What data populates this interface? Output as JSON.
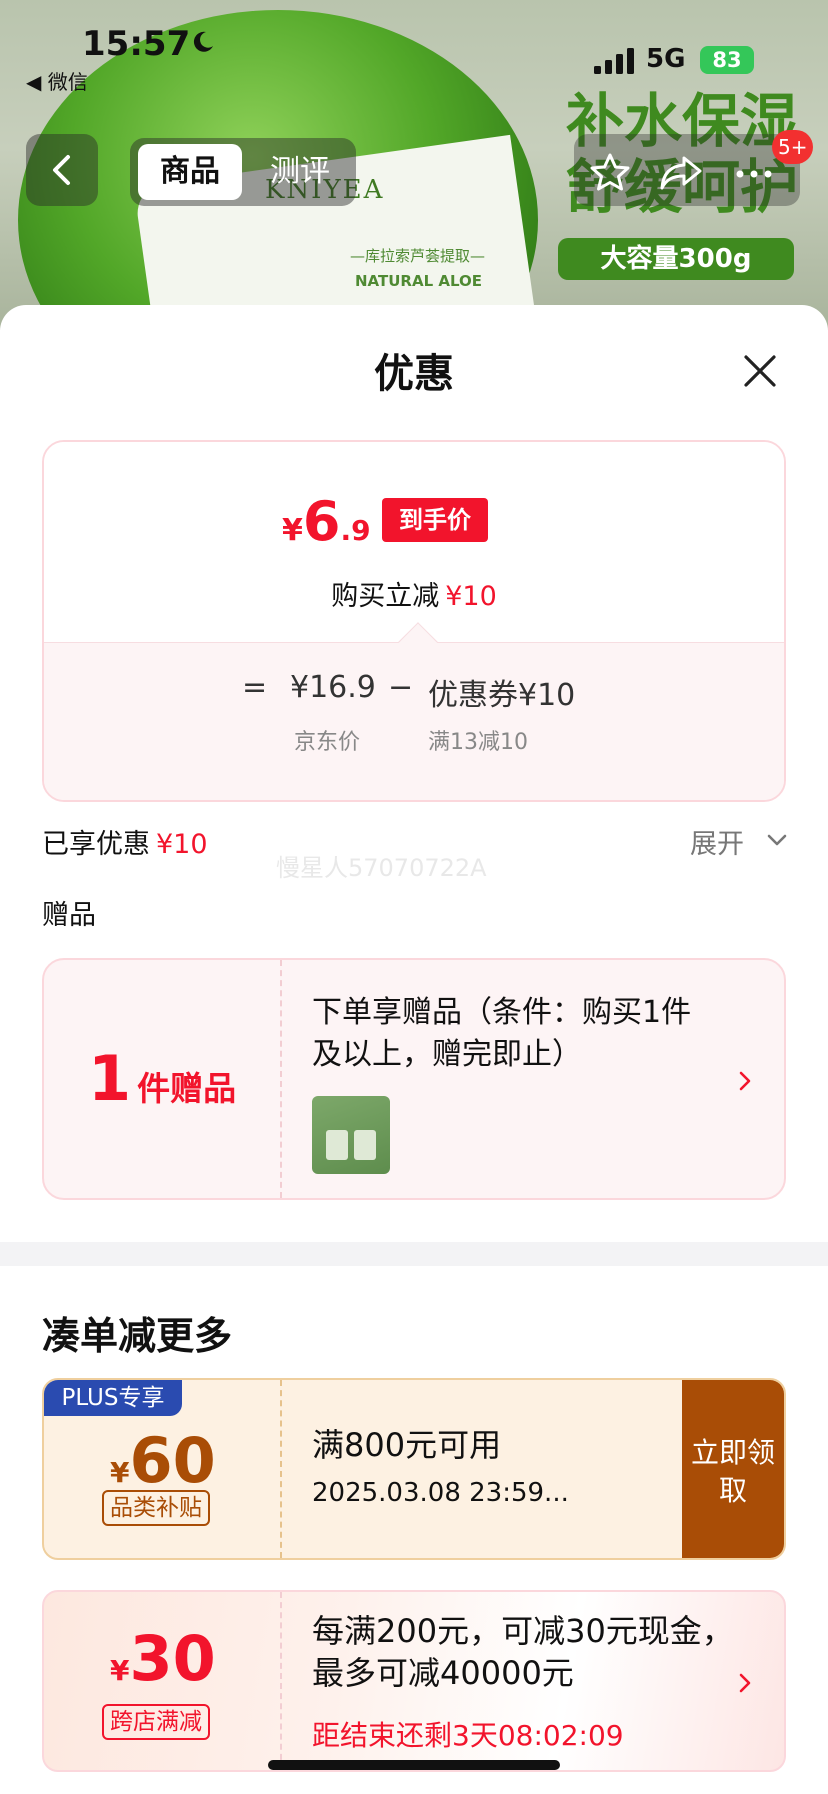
{
  "status_bar": {
    "time": "15:57",
    "back_app": "◀ 微信",
    "network": "5G",
    "battery": "83"
  },
  "product_ad": {
    "brand": "KNIYEA",
    "label_line1": "—库拉索芦荟提取—",
    "label_line2": "NATURAL ALOE",
    "headline": "补水保湿 舒缓呵护",
    "capacity": "大容量300g"
  },
  "nav": {
    "tabs": [
      {
        "label": "商品"
      },
      {
        "label": "测评"
      }
    ],
    "badge": "5+"
  },
  "sheet": {
    "title": "优惠",
    "price_card": {
      "currency": "¥",
      "final_int": "6",
      "final_dec": ".9",
      "final_tag": "到手价",
      "reduce_label": "购买立减",
      "reduce_value": "¥10",
      "formula": {
        "eq": "=",
        "jd_price": "¥16.9",
        "minus": "−",
        "coupon": "优惠券¥10",
        "jd_price_label": "京东价",
        "coupon_label": "满13减10"
      }
    },
    "enjoyed": {
      "label": "已享优惠",
      "value": "¥10",
      "expand": "展开"
    },
    "watermark": "慢星人57070722A",
    "gifts": {
      "heading": "赠品",
      "count_num": "1",
      "count_unit": "件赠品",
      "description": "下单享赠品（条件：购买1件及以上，赠完即止）"
    },
    "more": {
      "heading": "凑单减更多",
      "coupons": [
        {
          "tag": "PLUS专享",
          "currency": "¥",
          "amount": "60",
          "type": "品类补贴",
          "condition": "满800元可用",
          "expiry": "2025.03.08 23:59...",
          "button": "立即领取"
        },
        {
          "currency": "¥",
          "amount": "30",
          "type": "跨店满减",
          "description": "每满200元，可减30元现金，最多可减40000元",
          "countdown": "距结束还剩3天08:02:09"
        }
      ]
    }
  },
  "colors": {
    "accent_red": "#f2142c",
    "plus_blue": "#2a4bb0",
    "coupon_brown": "#a94d06",
    "green_brand": "#3f8a1f"
  }
}
